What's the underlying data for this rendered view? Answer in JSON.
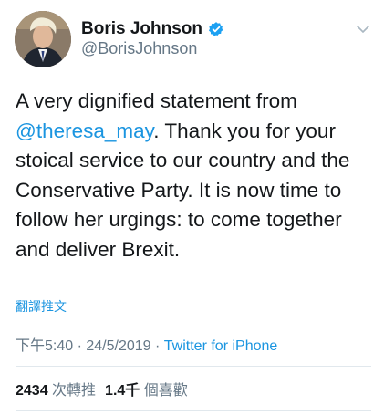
{
  "author": {
    "display_name": "Boris Johnson",
    "handle": "@BorisJohnson",
    "verified": true
  },
  "tweet": {
    "line1": "A very dignified statement from",
    "mention": "@theresa_may",
    "line2_rest": ". Thank you for your",
    "line3": "stoical service to our country and the",
    "line4": "Conservative Party. It is now time to",
    "line5": "follow her urgings: to come together",
    "line6": "and deliver Brexit."
  },
  "translate_label": "翻譯推文",
  "meta": {
    "time": "下午5:40",
    "separator": " · ",
    "date": "24/5/2019",
    "source": "Twitter for iPhone"
  },
  "stats": {
    "retweets_count": "2434",
    "retweets_label": " 次轉推",
    "likes_count": "1.4千",
    "likes_label": " 個喜歡"
  },
  "colors": {
    "link": "#1b95e0",
    "secondary_text": "#657786",
    "primary_text": "#14171a"
  },
  "icons": {
    "verified": "verified-badge-icon",
    "menu": "chevron-down-icon"
  }
}
